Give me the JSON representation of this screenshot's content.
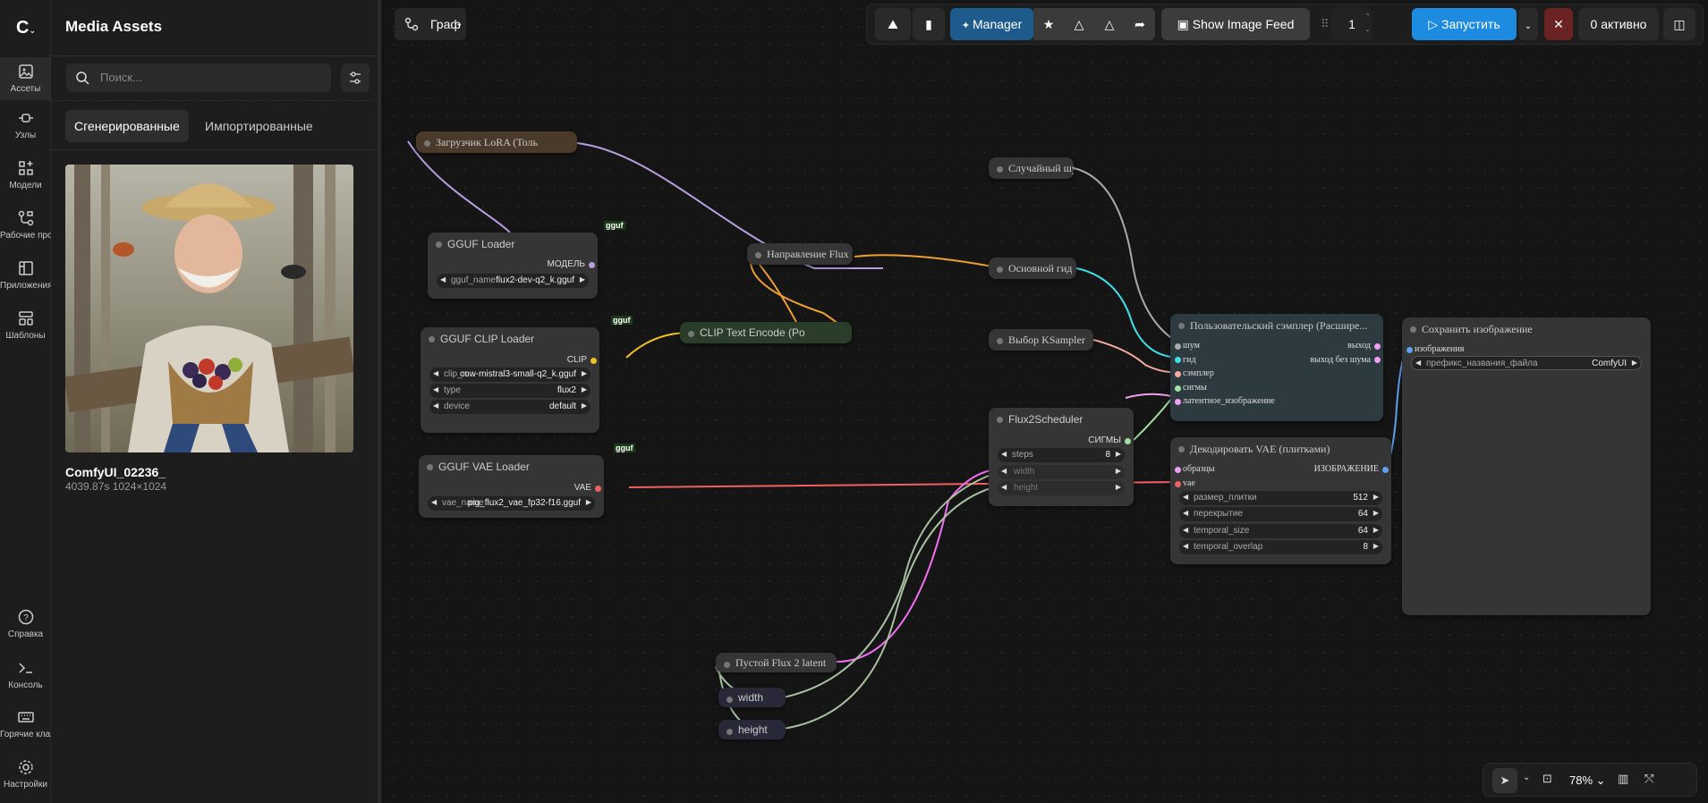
{
  "sidebar": {
    "items": [
      {
        "label": "Ассеты",
        "icon": "image-icon"
      },
      {
        "label": "Узлы",
        "icon": "nodes-icon"
      },
      {
        "label": "Модели",
        "icon": "models-icon"
      },
      {
        "label": "Рабочие процессы",
        "icon": "workflow-icon"
      },
      {
        "label": "Приложения",
        "icon": "apps-icon"
      },
      {
        "label": "Шаблоны",
        "icon": "templates-icon"
      }
    ],
    "bottom": [
      {
        "label": "Справка"
      },
      {
        "label": "Консоль"
      },
      {
        "label": "Горячие клавиши"
      },
      {
        "label": "Настройки"
      }
    ]
  },
  "panel": {
    "title": "Media Assets",
    "search_placeholder": "Поиск...",
    "tab_generated": "Сгенерированные",
    "tab_imported": "Импортированные",
    "asset": {
      "name": "ComfyUI_02236_",
      "meta": "4039.87s  1024×1024"
    }
  },
  "toolbar": {
    "graph_label": "Граф",
    "manager": "Manager",
    "image_feed": "Show Image Feed",
    "batch": "1",
    "run": "Запустить",
    "active": "0 активно"
  },
  "nodes": {
    "lora": "Загрузчик LoRA (Толь",
    "gguf_loader": {
      "title": "GGUF Loader",
      "out": "МОДЕЛЬ",
      "w_label": "gguf_name",
      "w_value": "flux2-dev-q2_k.gguf",
      "tag": "gguf"
    },
    "clip_loader": {
      "title": "GGUF CLIP Loader",
      "out": "CLIP",
      "w1_label": "clip_n...",
      "w1_value": "cow-mistral3-small-q2_k.gguf",
      "w2_label": "type",
      "w2_value": "flux2",
      "w3_label": "device",
      "w3_value": "default",
      "tag": "gguf"
    },
    "vae_loader": {
      "title": "GGUF VAE Loader",
      "out": "VAE",
      "w_label": "vae_name",
      "w_value": "pig_flux2_vae_fp32-f16.gguf",
      "tag": "gguf"
    },
    "flux_guidance": "Направление Flux",
    "clip_text": "CLIP Text Encode (Po",
    "random_noise": "Случайный шум",
    "basic_guider": "Основной гид",
    "ksampler_select": "Выбор KSampler",
    "scheduler": {
      "title": "Flux2Scheduler",
      "out": "СИГМЫ",
      "steps_label": "steps",
      "steps_value": "8",
      "width": "width",
      "height": "height"
    },
    "sampler": {
      "title": "Пользовательский сэмплер (Расширe...",
      "in": [
        "шум",
        "гид",
        "сэмплер",
        "сигмы",
        "латентное_изображение"
      ],
      "out1": "выход",
      "out2": "выход без шума"
    },
    "decode": {
      "title": "Декодировать VAE (плитками)",
      "in1": "образцы",
      "in2": "vae",
      "out": "ИЗОБРАЖЕНИЕ",
      "widgets": [
        {
          "l": "размер_плитки",
          "v": "512"
        },
        {
          "l": "перекрытие",
          "v": "64"
        },
        {
          "l": "temporal_size",
          "v": "64"
        },
        {
          "l": "temporal_overlap",
          "v": "8"
        }
      ]
    },
    "save": {
      "title": "Сохранить изображение",
      "in": "изображения",
      "w_label": "префикс_названия_файла",
      "w_value": "ComfyUI"
    },
    "empty_latent": "Пустой Flux 2 latent",
    "width": "width",
    "height": "height"
  },
  "zoom": "78%"
}
